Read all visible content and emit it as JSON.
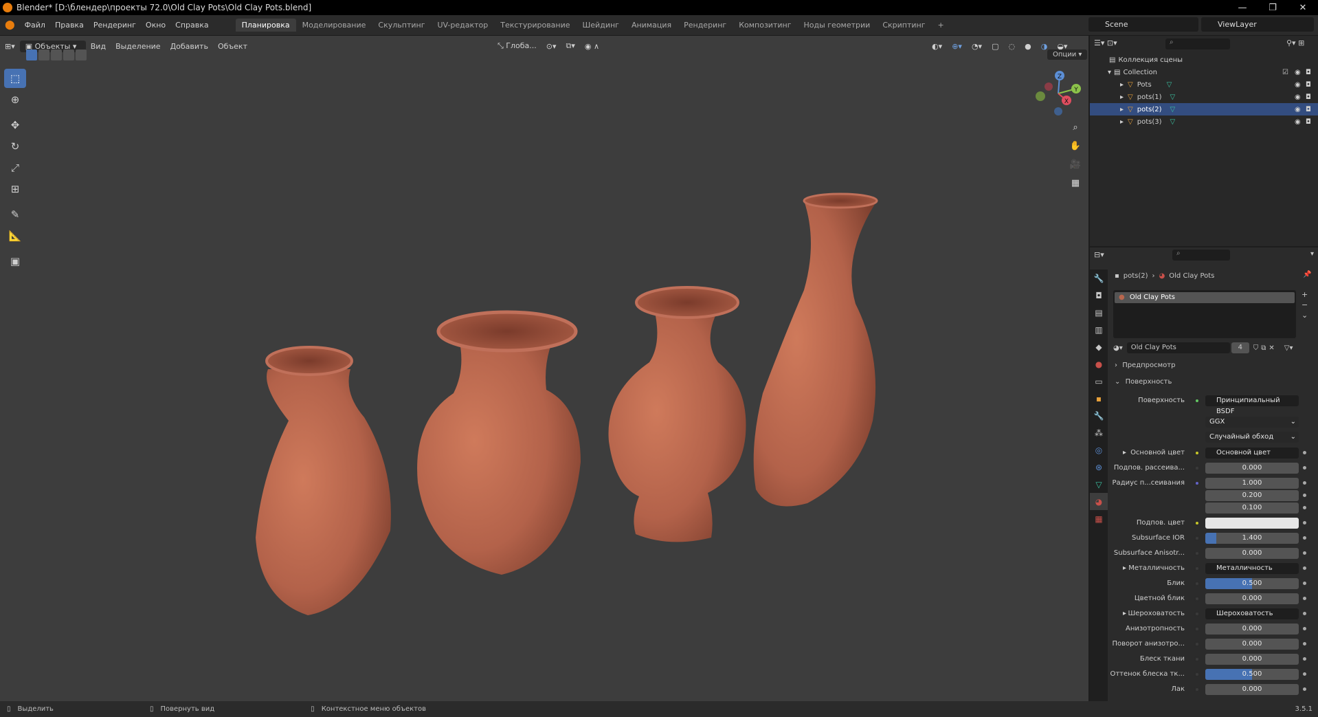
{
  "window": {
    "title": "Blender* [D:\\блендер\\проекты 72.0\\Old Clay Pots\\Old Clay Pots.blend]",
    "minimize": "—",
    "maximize": "❐",
    "close": "✕"
  },
  "menu": [
    "Файл",
    "Правка",
    "Рендеринг",
    "Окно",
    "Справка"
  ],
  "workspaces": [
    "Планировка",
    "Моделирование",
    "Скульптинг",
    "UV-редактор",
    "Текстурирование",
    "Шейдинг",
    "Анимация",
    "Рендеринг",
    "Композитинг",
    "Ноды геометрии",
    "Скриптинг"
  ],
  "workspace_add": "+",
  "scene": {
    "name": "Scene",
    "view_layer": "ViewLayer"
  },
  "viewport_header": {
    "mode": "Объекты",
    "menus": [
      "Вид",
      "Выделение",
      "Добавить",
      "Объект"
    ],
    "orientation": "Глоба...",
    "options": "Опции"
  },
  "gizmo_axes": {
    "z": "Z",
    "y": "Y",
    "x": "X"
  },
  "outliner": {
    "root": "Коллекция сцены",
    "collection": "Collection",
    "items": [
      {
        "name": "Pots",
        "selected": false
      },
      {
        "name": "pots(1)",
        "selected": false
      },
      {
        "name": "pots(2)",
        "selected": true
      },
      {
        "name": "pots(3)",
        "selected": false
      }
    ]
  },
  "properties": {
    "breadcrumb_object": "pots(2)",
    "breadcrumb_material": "Old Clay Pots",
    "slot": "Old Clay Pots",
    "material_name": "Old Clay Pots",
    "users": "4",
    "panel_preview": "Предпросмотр",
    "panel_surface": "Поверхность",
    "surface_label": "Поверхность",
    "surface_value": "Принципиальный BSDF",
    "distribution": "GGX",
    "subsurface_method": "Случайный обход",
    "rows": [
      {
        "label": "Основной цвет",
        "value": "Основной цвет",
        "kind": "link",
        "dot": "yellow",
        "expand": true
      },
      {
        "label": "Подпов. рассеива...",
        "value": "0.000",
        "kind": "num",
        "dot": "grey",
        "fill": 0
      },
      {
        "label": "Радиус п...сеивания",
        "value": "1.000",
        "kind": "num",
        "dot": "blue",
        "fill": 0
      },
      {
        "label": "",
        "value": "0.200",
        "kind": "num",
        "dot": "none",
        "fill": 0
      },
      {
        "label": "",
        "value": "0.100",
        "kind": "num",
        "dot": "none",
        "fill": 0
      },
      {
        "label": "Подпов. цвет",
        "value": "",
        "kind": "white",
        "dot": "yellow"
      },
      {
        "label": "Subsurface IOR",
        "value": "1.400",
        "kind": "num",
        "dot": "grey",
        "fill": 0.12
      },
      {
        "label": "Subsurface Anisotr...",
        "value": "0.000",
        "kind": "num",
        "dot": "grey",
        "fill": 0
      },
      {
        "label": "Металличность",
        "value": "Металличность",
        "kind": "link",
        "dot": "grey",
        "expand": true
      },
      {
        "label": "Блик",
        "value": "0.500",
        "kind": "num",
        "dot": "grey",
        "fill": 0.5
      },
      {
        "label": "Цветной блик",
        "value": "0.000",
        "kind": "num",
        "dot": "grey",
        "fill": 0
      },
      {
        "label": "Шероховатость",
        "value": "Шероховатость",
        "kind": "link",
        "dot": "grey",
        "expand": true
      },
      {
        "label": "Анизотропность",
        "value": "0.000",
        "kind": "num",
        "dot": "grey",
        "fill": 0
      },
      {
        "label": "Поворот анизотро...",
        "value": "0.000",
        "kind": "num",
        "dot": "grey",
        "fill": 0
      },
      {
        "label": "Блеск ткани",
        "value": "0.000",
        "kind": "num",
        "dot": "grey",
        "fill": 0
      },
      {
        "label": "Оттенок блеска тк...",
        "value": "0.500",
        "kind": "num",
        "dot": "grey",
        "fill": 0.5
      },
      {
        "label": "Лак",
        "value": "0.000",
        "kind": "num",
        "dot": "grey",
        "fill": 0
      }
    ]
  },
  "statusbar": {
    "select": "Выделить",
    "rotate": "Повернуть вид",
    "context": "Контекстное меню объектов",
    "version": "3.5.1"
  },
  "colors": {
    "accent": "#4772b3",
    "selected_row": "#334d80",
    "viewport_bg": "#3d3d3d",
    "clay": "#b8664d"
  }
}
